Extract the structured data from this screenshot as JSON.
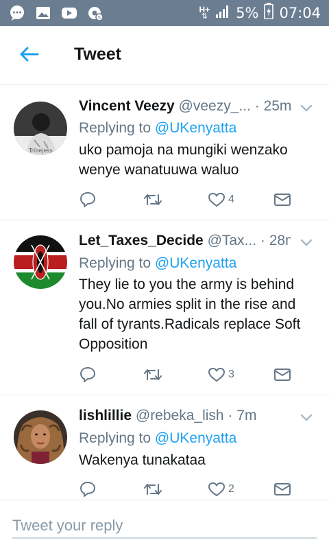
{
  "status_bar": {
    "icons": [
      "chat-icon",
      "gallery-icon",
      "youtube-icon",
      "settings-icon"
    ],
    "network": "H+",
    "battery": "5%",
    "time": "07:04"
  },
  "header": {
    "title": "Tweet",
    "back_icon": "arrow-left-icon",
    "accent": "#1da1f2"
  },
  "tweets": [
    {
      "name": "Vincent Veezy",
      "handle": "@veezy_...",
      "time": "· 25m",
      "replying_prefix": "Replying to ",
      "replying_to": "@UKenyatta",
      "text": "uko pamoja na mungiki wenzako wenye wanatuuwa waluo",
      "avatar_text": "Tribejess",
      "likes": "4"
    },
    {
      "name": "Let_Taxes_Decide",
      "handle": "@Tax...",
      "time": "· 28m",
      "replying_prefix": "Replying to ",
      "replying_to": "@UKenyatta",
      "text": "They lie to you the army is behind you.No armies split in the rise and fall of tyrants.Radicals replace Soft Opposition",
      "likes": "3"
    },
    {
      "name": "lishlillie",
      "handle": "@rebeka_lish",
      "time": "· 7m",
      "replying_prefix": "Replying to ",
      "replying_to": "@UKenyatta",
      "text": "Wakenya tunakataa",
      "likes": "2"
    }
  ],
  "reply_bar": {
    "placeholder": "Tweet your reply"
  },
  "colors": {
    "status_bar": "#6b7d90",
    "accent": "#1da1f2",
    "secondary_text": "#657786",
    "divider": "#e1e8ed"
  }
}
